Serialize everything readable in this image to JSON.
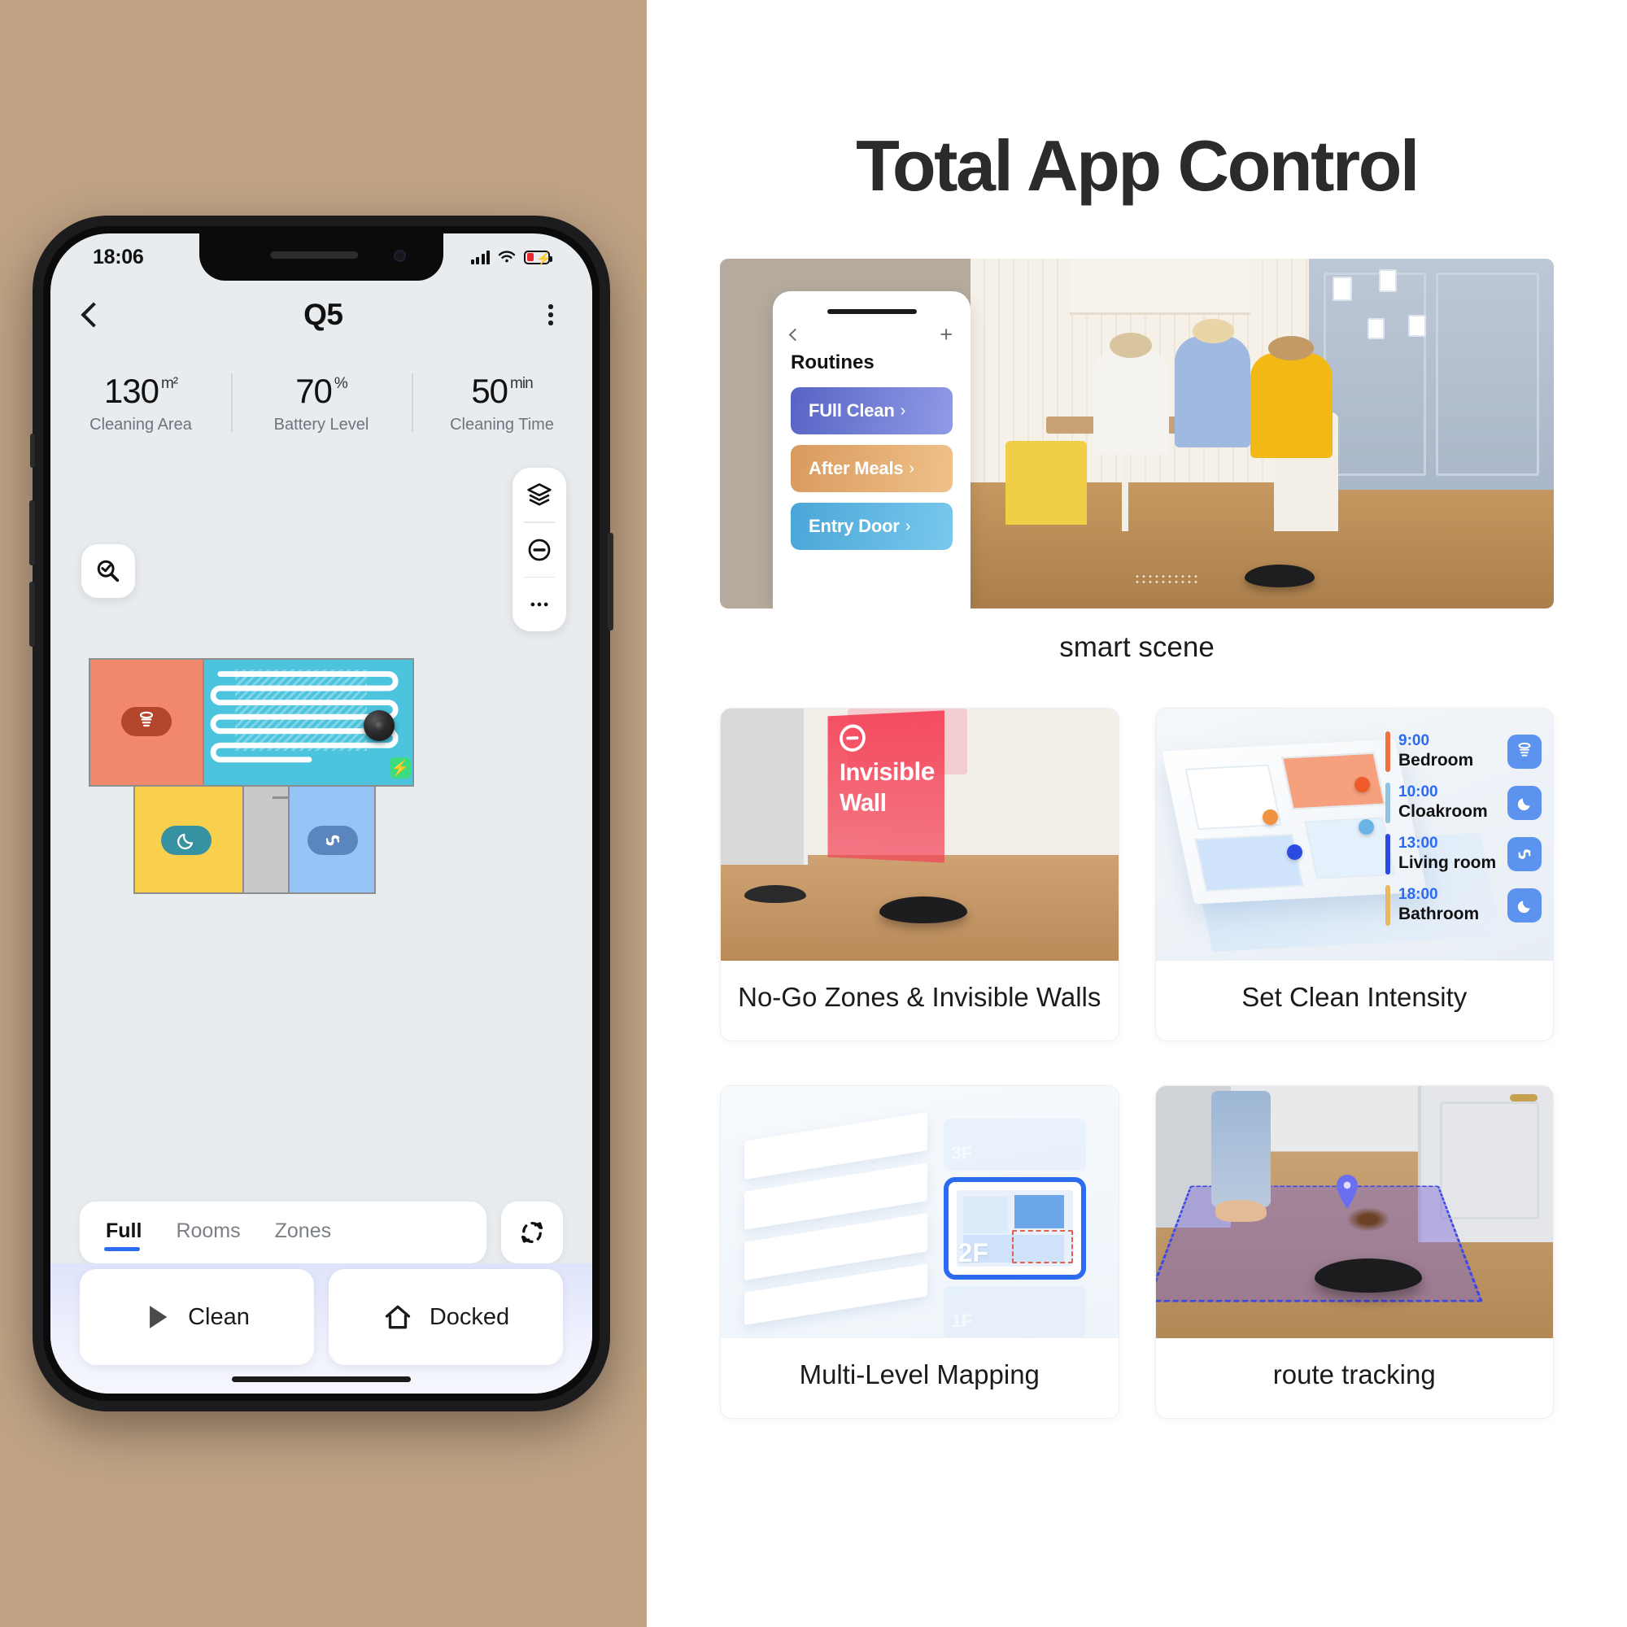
{
  "headline": "Total App Control",
  "phone": {
    "status": {
      "time": "18:06",
      "signal_icon": "signal-bars-icon",
      "wifi_icon": "wifi-icon",
      "battery_icon": "battery-charging-icon"
    },
    "header": {
      "back_icon": "back-chevron-icon",
      "title": "Q5",
      "menu_icon": "kebab-menu-icon"
    },
    "stats": [
      {
        "value": "130",
        "unit": "m²",
        "label": "Cleaning Area"
      },
      {
        "value": "70",
        "unit": "%",
        "label": "Battery Level"
      },
      {
        "value": "50",
        "unit": "min",
        "label": "Cleaning Time"
      }
    ],
    "map_controls": {
      "zone_icon": "select-zone-icon",
      "layers_icon": "map-layers-icon",
      "nogo_icon": "no-go-zone-icon",
      "more_icon": "more-options-icon"
    },
    "map": {
      "rooms": [
        {
          "name": "orange-room",
          "color": "#f2886b",
          "mode_icon": "max-suction-icon"
        },
        {
          "name": "cyan-room",
          "color": "#4cc4de",
          "mode_icon": "cleaning-path"
        },
        {
          "name": "yellow-room",
          "color": "#f9cf4e",
          "mode_icon": "quiet-moon-icon"
        },
        {
          "name": "grey-room",
          "color": "#c9c9c9",
          "mode_icon": "none"
        },
        {
          "name": "blue-room",
          "color": "#96c4f7",
          "mode_icon": "vortex-spiral-icon"
        }
      ],
      "robot_icon": "robot-vacuum-icon",
      "dock_icon": "charging-dock-icon"
    },
    "tabs": [
      {
        "label": "Full",
        "active": true
      },
      {
        "label": "Rooms",
        "active": false
      },
      {
        "label": "Zones",
        "active": false
      }
    ],
    "refresh_icon": "refresh-map-icon",
    "actions": [
      {
        "label": "Clean",
        "icon": "play-icon"
      },
      {
        "label": "Docked",
        "icon": "home-dock-icon"
      }
    ]
  },
  "hero": {
    "caption": "smart scene",
    "routines_panel": {
      "back_icon": "back-chevron-icon",
      "add_icon": "plus-icon",
      "title": "Routines",
      "items": [
        {
          "label": "FUll Clean",
          "arrow": "›",
          "color": "#5764c4"
        },
        {
          "label": "After Meals",
          "arrow": "›",
          "color": "#d99a5e"
        },
        {
          "label": "Entry Door",
          "arrow": "›",
          "color": "#4aa6d8"
        }
      ]
    }
  },
  "cards": [
    {
      "id": "no-go-zones",
      "caption": "No-Go Zones & Invisible Walls",
      "overlay": {
        "icon": "no-entry-icon",
        "line1": "Invisible",
        "line2": "Wall",
        "color": "#f43e54"
      }
    },
    {
      "id": "clean-intensity",
      "caption": "Set Clean Intensity",
      "schedule": [
        {
          "time": "9:00",
          "room": "Bedroom",
          "icon": "max-suction-icon",
          "bar_color": "#f0733f"
        },
        {
          "time": "10:00",
          "room": "Cloakroom",
          "icon": "quiet-moon-icon",
          "bar_color": "#8fc2dd"
        },
        {
          "time": "13:00",
          "room": "Living room",
          "icon": "vortex-spiral-icon",
          "bar_color": "#2b4be0"
        },
        {
          "time": "18:00",
          "room": "Bathroom",
          "icon": "quiet-moon-icon",
          "bar_color": "#e8b763"
        }
      ]
    },
    {
      "id": "multi-level-mapping",
      "caption": "Multi-Level Mapping",
      "floors": [
        {
          "label": "3F",
          "active": false
        },
        {
          "label": "2F",
          "active": true
        },
        {
          "label": "1F",
          "active": false
        }
      ]
    },
    {
      "id": "route-tracking",
      "caption": "route tracking",
      "overlay": {
        "pin_icon": "location-pin-icon",
        "zone_color": "#7864d2"
      }
    }
  ]
}
